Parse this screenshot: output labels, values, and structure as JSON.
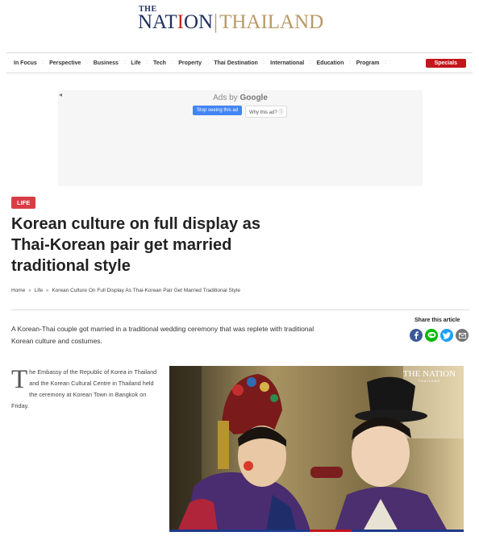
{
  "logo": {
    "the": "THE",
    "nation": [
      "NAT",
      "I",
      "ON"
    ],
    "separator": "|",
    "thailand": "THAILAND"
  },
  "nav": {
    "items": [
      "In Focus",
      "Perspective",
      "Business",
      "Life",
      "Tech",
      "Property",
      "Thai Destination",
      "International",
      "Education",
      "Program"
    ],
    "separator": "::",
    "specials": "Specials"
  },
  "ad": {
    "back": "◂",
    "ads_by": "Ads by",
    "google": "Google",
    "stop": "Stop seeing this ad",
    "why": "Why this ad? ⓘ"
  },
  "article": {
    "category": "LIFE",
    "headline": "Korean culture on full display as Thai-Korean pair get married traditional style",
    "breadcrumb": [
      "Home",
      "Life",
      "Korean Culture On Full Display As Thai-Korean Pair Get Married Traditional Style"
    ],
    "breadcrumb_sep": "»",
    "lead": "A Korean-Thai couple got married in a traditional wedding ceremony that was replete with traditional Korean culture and costumes.",
    "share_label": "Share this article",
    "share_buttons": [
      {
        "name": "facebook-icon",
        "glyph": "f",
        "color": "#3b5998"
      },
      {
        "name": "line-icon",
        "glyph": "LINE",
        "color": "#00b900"
      },
      {
        "name": "twitter-icon",
        "glyph": "t",
        "color": "#1da1f2"
      },
      {
        "name": "email-icon",
        "glyph": "✉",
        "color": "#777777"
      }
    ],
    "drop_cap": "T",
    "body": "he Embassy of the Republic of Korea in Thailand and the Korean Cultural Centre in Thailand held the ceremony at Korean Town in Bangkok on Friday.",
    "photo_logo": {
      "main": "THE NATION",
      "sub": "THAILAND"
    }
  },
  "colors": {
    "brand_navy": "#1d2f5c",
    "brand_gold": "#b89a66",
    "accent_red": "#c4141c",
    "badge_red": "#d63e45"
  }
}
